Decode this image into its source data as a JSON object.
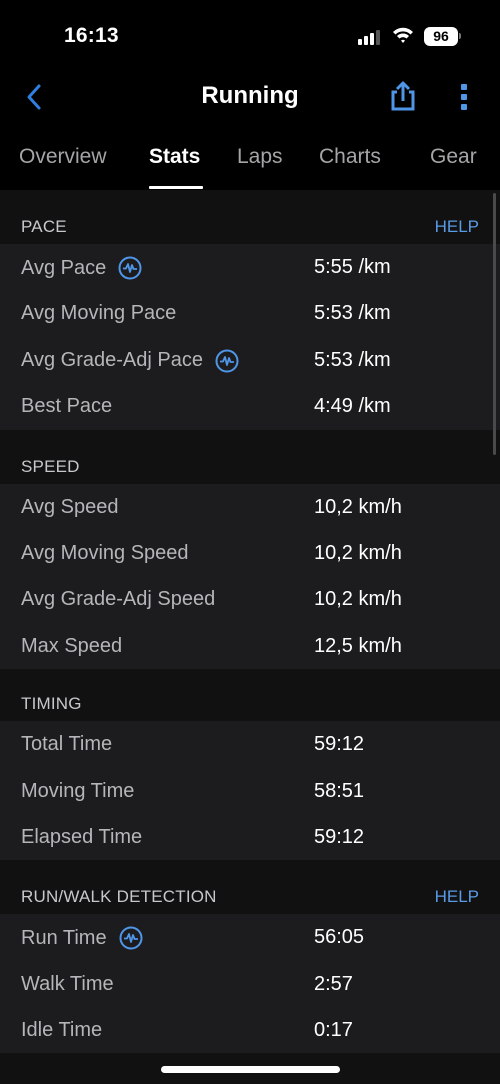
{
  "status_bar": {
    "time": "16:13",
    "battery": "96",
    "icons": [
      "signal-icon",
      "wifi-icon",
      "battery-icon"
    ]
  },
  "nav": {
    "title": "Running",
    "back_icon": "chevron-left-icon",
    "share_icon": "share-icon",
    "more_icon": "more-vertical-icon"
  },
  "tabs": [
    {
      "label": "Overview",
      "active": false
    },
    {
      "label": "Stats",
      "active": true
    },
    {
      "label": "Laps",
      "active": false
    },
    {
      "label": "Charts",
      "active": false
    },
    {
      "label": "Gear",
      "active": false
    }
  ],
  "colors": {
    "accent": "#5a9ae6",
    "background": "#111112",
    "row_background": "#1c1c1e"
  },
  "sections": [
    {
      "title": "PACE",
      "help": "HELP",
      "rows": [
        {
          "label": "Avg Pace",
          "value": "5:55 /km",
          "icon": "activity-info-icon"
        },
        {
          "label": "Avg Moving Pace",
          "value": "5:53 /km"
        },
        {
          "label": "Avg Grade-Adj Pace",
          "value": "5:53 /km",
          "icon": "activity-info-icon"
        },
        {
          "label": "Best Pace",
          "value": "4:49 /km"
        }
      ]
    },
    {
      "title": "SPEED",
      "rows": [
        {
          "label": "Avg Speed",
          "value": "10,2 km/h"
        },
        {
          "label": "Avg Moving Speed",
          "value": "10,2 km/h"
        },
        {
          "label": "Avg Grade-Adj Speed",
          "value": "10,2 km/h"
        },
        {
          "label": "Max Speed",
          "value": "12,5 km/h"
        }
      ]
    },
    {
      "title": "TIMING",
      "rows": [
        {
          "label": "Total Time",
          "value": "59:12"
        },
        {
          "label": "Moving Time",
          "value": "58:51"
        },
        {
          "label": "Elapsed Time",
          "value": "59:12"
        }
      ]
    },
    {
      "title": "RUN/WALK DETECTION",
      "help": "HELP",
      "rows": [
        {
          "label": "Run Time",
          "value": "56:05",
          "icon": "activity-info-icon"
        },
        {
          "label": "Walk Time",
          "value": "2:57"
        },
        {
          "label": "Idle Time",
          "value": "0:17"
        }
      ]
    }
  ]
}
